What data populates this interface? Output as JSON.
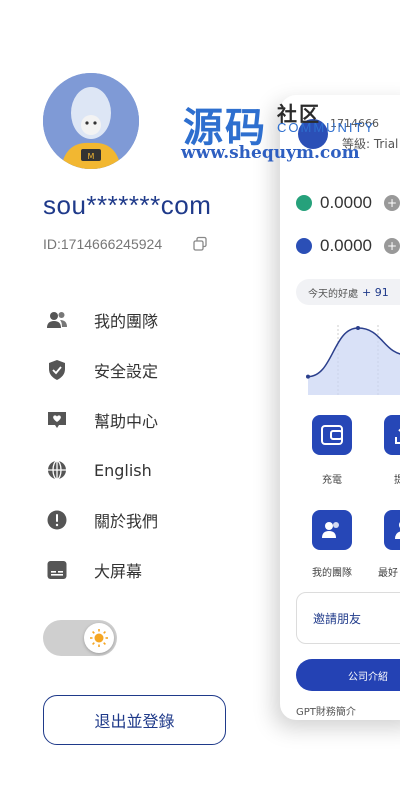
{
  "profile": {
    "username": "sou*******com",
    "user_id": "ID:1714666245924"
  },
  "menu": [
    {
      "label": "我的團隊",
      "icon": "team-icon"
    },
    {
      "label": "安全設定",
      "icon": "shield-icon"
    },
    {
      "label": "幫助中心",
      "icon": "help-icon"
    },
    {
      "label": "English",
      "icon": "globe-icon"
    },
    {
      "label": "關於我們",
      "icon": "info-icon"
    },
    {
      "label": "大屏幕",
      "icon": "screen-icon"
    }
  ],
  "theme_toggle": {
    "state": "light",
    "icon": "sun-icon"
  },
  "logout_label": "退出並登錄",
  "watermark": {
    "big": "源码",
    "small": "社区",
    "community": "COMMUNITY",
    "url": "www.shequym.com"
  },
  "card": {
    "header_id": "1714666",
    "level": "等級:  Trial",
    "balances": [
      {
        "value": "0.0000",
        "coin_color": "#26a17b"
      },
      {
        "value": "0.0000",
        "coin_color": "#2b4fb6"
      }
    ],
    "today_pill": {
      "label": "今天的好處",
      "value": "+ 91"
    },
    "chart_data": {
      "type": "line",
      "values": [
        0.1,
        1.0,
        0.5
      ],
      "title": "",
      "xlabel": "",
      "ylabel": ""
    },
    "tiles": [
      {
        "label": "充電",
        "icon": "wallet-icon"
      },
      {
        "label": "提",
        "icon": "withdraw-icon"
      },
      {
        "label": "我的團隊",
        "icon": "team-icon"
      },
      {
        "label": "最好",
        "icon": "person-icon"
      }
    ],
    "invite_label": "邀請朋友",
    "company_label": "公司介紹",
    "gpt_label": "GPT財務簡介"
  },
  "colors": {
    "primary": "#1f3a8a",
    "accent": "#2647b7",
    "watermark_blue": "#2e6fcf"
  }
}
